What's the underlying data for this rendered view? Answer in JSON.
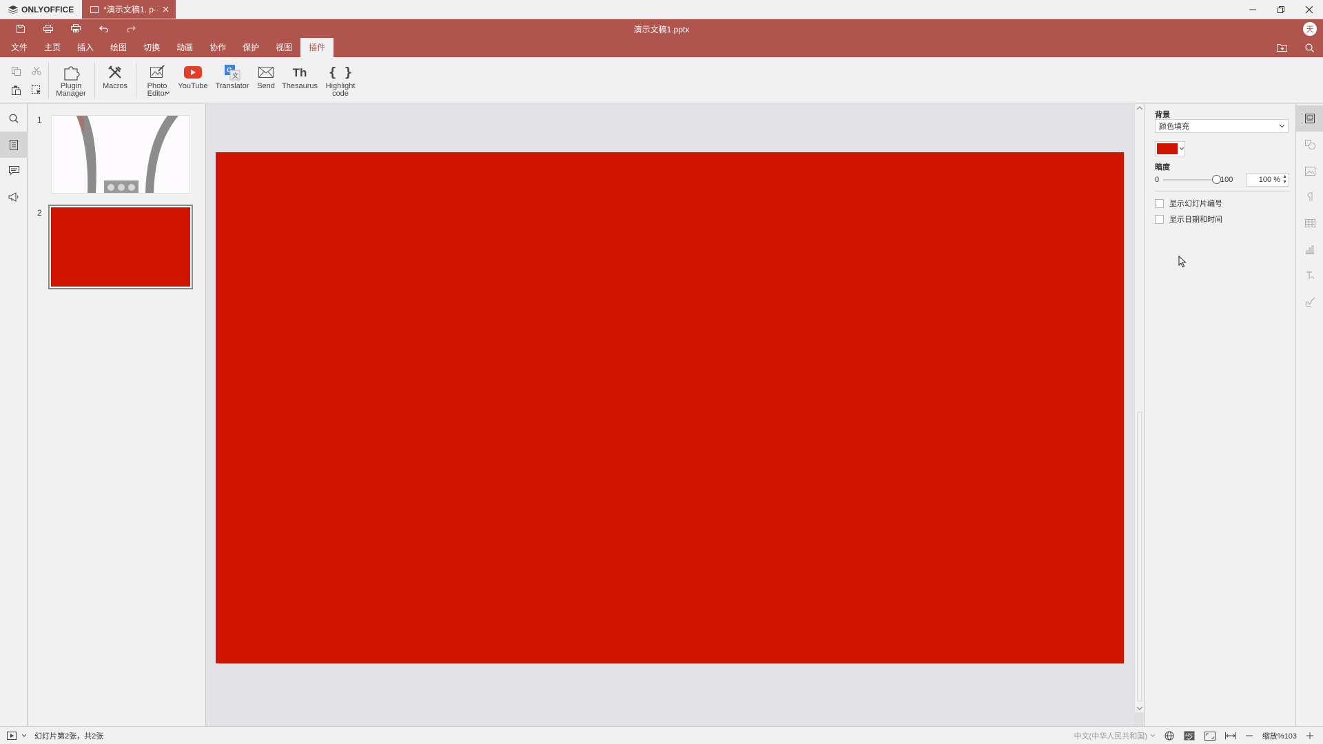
{
  "app": {
    "brand": "ONLYOFFICE",
    "tab_title": "*演示文稿1. p···",
    "doc_title": "演示文稿1.pptx",
    "user_initial": "天"
  },
  "menu": {
    "items": [
      "文件",
      "主页",
      "插入",
      "绘图",
      "切换",
      "动画",
      "协作",
      "保护",
      "视图",
      "插件"
    ],
    "active": "插件"
  },
  "toolbar": {
    "plugin_manager": "Plugin Manager",
    "macros": "Macros",
    "photo_editor": "Photo Editor",
    "youtube": "YouTube",
    "translator": "Translator",
    "send": "Send",
    "thesaurus": "Thesaurus",
    "thesaurus_icon_text": "Th",
    "highlight_code": "Highlight code",
    "highlight_icon_text": "{ }"
  },
  "slides": {
    "thumbnails": [
      {
        "number": "1"
      },
      {
        "number": "2",
        "fill": "#cf1500"
      }
    ],
    "current_fill": "#cf1500"
  },
  "right_panel": {
    "background_label": "背景",
    "fill_type": "颜色填充",
    "fill_color": "#cf1500",
    "opacity_label": "暗度",
    "opacity_min": "0",
    "opacity_max": "100",
    "opacity_value": "100 %",
    "opacity_level": 100,
    "show_slide_number": "显示幻灯片编号",
    "show_date_time": "显示日期和时间"
  },
  "statusbar": {
    "slide_info": "幻灯片第2张，共2张",
    "language": "中文(中华人民共和国)",
    "zoom": "缩放%103"
  },
  "colors": {
    "brand": "#b0544e",
    "slide": "#cf1500"
  }
}
